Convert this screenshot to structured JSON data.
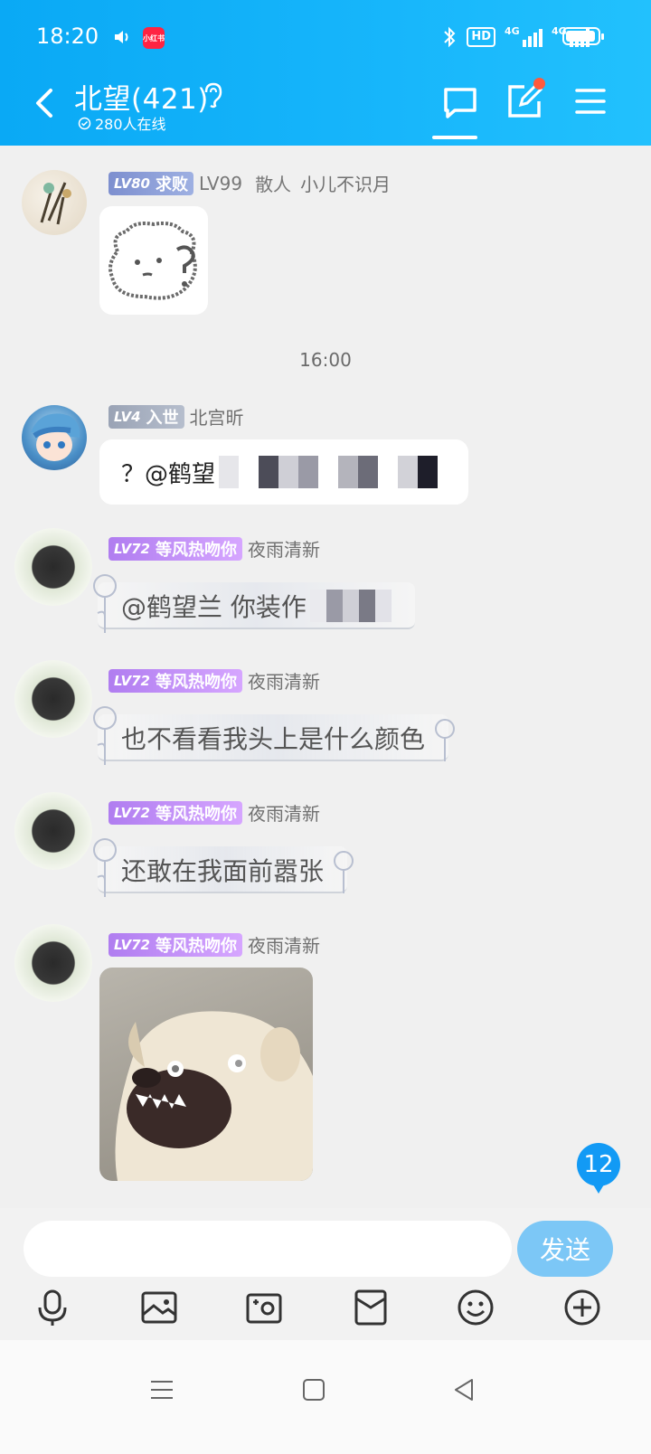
{
  "status_bar": {
    "time": "18:20",
    "app_badge": "小红书",
    "hd": "HD",
    "net1": "4G",
    "net2": "4G",
    "battery_level": 0.95
  },
  "header": {
    "title": "北望(421)",
    "online": "280人在线"
  },
  "messages": [
    {
      "level": "LV80",
      "rank": "求败",
      "title_tag": "LV99",
      "extra": "散人",
      "name": "小儿不识月",
      "type": "sticker"
    },
    {
      "level": "LV4",
      "rank": "入世",
      "name": "北宫昕",
      "text": "？@鹤望"
    },
    {
      "level": "LV72",
      "rank": "等风热吻你",
      "name": "夜雨清新",
      "text": "@鹤望兰 你装作"
    },
    {
      "level": "LV72",
      "rank": "等风热吻你",
      "name": "夜雨清新",
      "text": "也不看看我头上是什么颜色"
    },
    {
      "level": "LV72",
      "rank": "等风热吻你",
      "name": "夜雨清新",
      "text": "还敢在我面前嚣张"
    },
    {
      "level": "LV72",
      "rank": "等风热吻你",
      "name": "夜雨清新",
      "type": "image"
    }
  ],
  "timestamp": "16:00",
  "unread_count": "12",
  "input": {
    "placeholder": "",
    "send_label": "发送"
  },
  "toolbar_icons": [
    "mic-icon",
    "image-icon",
    "camera-icon",
    "redpacket-icon",
    "emoji-icon",
    "plus-icon"
  ],
  "nav_icons": [
    "menu-icon",
    "home-icon",
    "back-icon"
  ]
}
